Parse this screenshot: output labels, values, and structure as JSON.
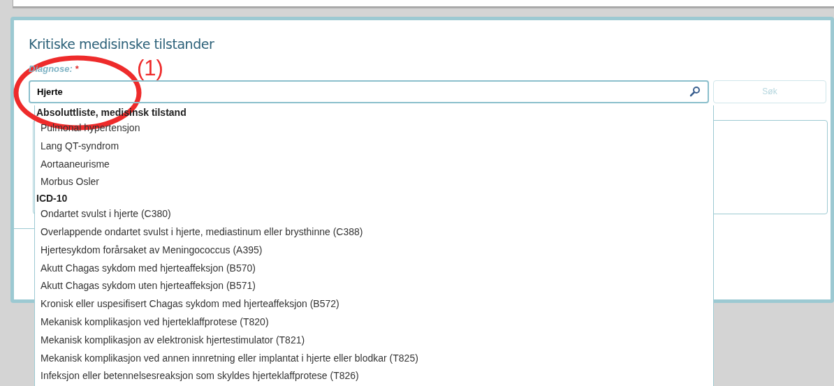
{
  "section": {
    "title": "Kritiske medisinske tilstander"
  },
  "diagnosis_field": {
    "label": "Diagnose:",
    "required_mark": "*",
    "value": "Hjerte"
  },
  "search_button": {
    "label": "Søk",
    "disabled": true
  },
  "annotation": {
    "label": "(1)"
  },
  "suggestions": [
    {
      "heading": "Absoluttliste, medisinsk tilstand",
      "items": [
        "Pulmonal hypertensjon",
        "Lang QT-syndrom",
        "Aortaaneurisme",
        "Morbus Osler"
      ]
    },
    {
      "heading": "ICD-10",
      "items": [
        "Ondartet svulst i hjerte (C380)",
        "Overlappende ondartet svulst i hjerte, mediastinum eller brysthinne (C388)",
        "Hjertesykdom forårsaket av Meningococcus (A395)",
        "Akutt Chagas sykdom med hjerteaffeksjon (B570)",
        "Akutt Chagas sykdom uten hjerteaffeksjon (B571)",
        "Kronisk eller uspesifisert Chagas sykdom med hjerteaffeksjon (B572)",
        "Mekanisk komplikasjon ved hjerteklaffprotese (T820)",
        "Mekanisk komplikasjon av elektronisk hjertestimulator (T821)",
        "Mekanisk komplikasjon ved annen innretning eller implantat i hjerte eller blodkar (T825)",
        "Infeksjon eller betennelsesreaksjon som skyldes hjerteklaffprotese (T826)"
      ]
    }
  ]
}
